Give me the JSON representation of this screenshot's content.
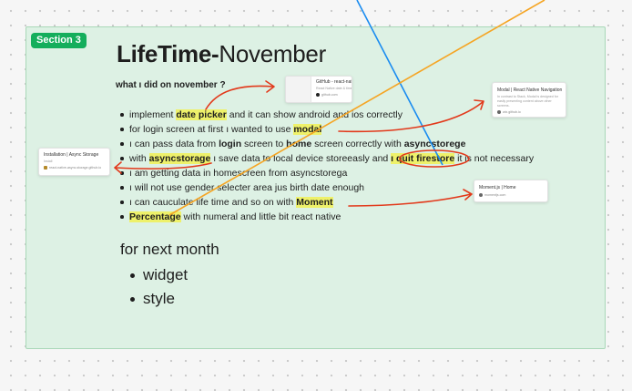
{
  "section": {
    "label": "Section 3"
  },
  "title": {
    "bold": "LifeTime-",
    "normal": "November"
  },
  "subtitle": "what ı did on november ?",
  "items": [
    {
      "pre": "implement ",
      "hl": "date picker",
      "post": " and it can show android and ios correctly"
    },
    {
      "pre": "for login screen at first ı wanted to  use ",
      "hl": "modal",
      "post": ""
    },
    {
      "pre": "ı can pass data from ",
      "b1": "login",
      "mid": " screen to ",
      "b2": "home",
      "mid2": " screen correctly with ",
      "b3": "asyncstorege"
    },
    {
      "pre": "with ",
      "hl": "asyncstorage",
      "mid": " ı save data to local device storeeasly and ",
      "hl2": "ı quit firestore",
      "post": " it is not necessary"
    },
    {
      "text": "ı am getting data in homescreen from asyncstorega"
    },
    {
      "text": "ı will not use gender selecter area jus birth date enough"
    },
    {
      "pre": "ı can cauculate life time and so on with ",
      "hl": "Moment",
      "post": ""
    },
    {
      "hl": "Percentage",
      "post": " with numeral and little bit react native"
    }
  ],
  "next_month": {
    "title": "for next month",
    "items": [
      "widget",
      "style"
    ]
  },
  "cards": {
    "github": {
      "title": "GitHub - react-native-datetimepicker/react-...",
      "desc": "React Native date & time picker component for iOS, Android and Windows",
      "url": "github.com"
    },
    "modal": {
      "title": "Modal | React Native Navigation",
      "desc": "In contrast to Stack, Modal is designed for easily presenting content above other screens.",
      "url": "wix.github.io"
    },
    "async": {
      "title": "Installation | Async Storage",
      "desc": "Install",
      "url": "react-native-async-storage.github.io"
    },
    "moment": {
      "title": "Moment.js | Home",
      "url": "momentjs.com"
    }
  },
  "colors": {
    "section_bg": "#ddf1e4",
    "badge": "#14ae5c",
    "highlight": "#eef16a",
    "arrow_red": "#e2391b",
    "line_orange": "#f5a524",
    "line_blue": "#1a8cf0"
  }
}
